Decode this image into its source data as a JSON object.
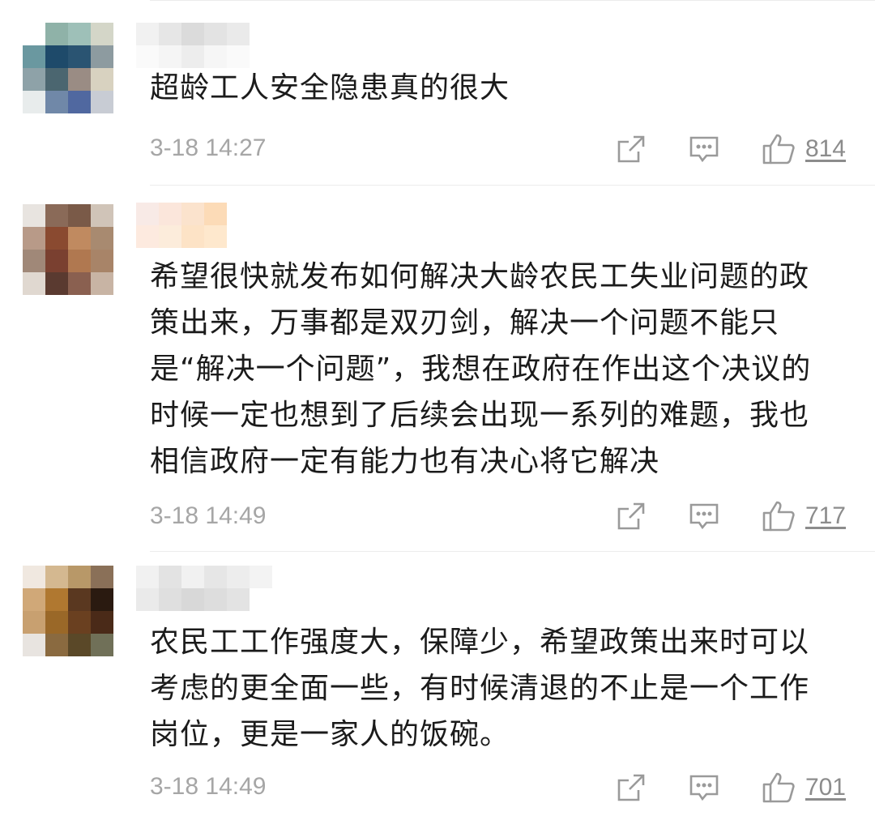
{
  "comments": [
    {
      "text": "超龄工人安全隐患真的很大",
      "time": "3-18 14:27",
      "likes": "814",
      "avatar_colors": [
        "#ffffff",
        "#8fb2a8",
        "#9ec0b8",
        "#d4d6c8",
        "#6a98a0",
        "#1e4a6a",
        "#2a5472",
        "#8d9ba0",
        "#8ea2a8",
        "#4b6670",
        "#9a8c84",
        "#d8d2c0",
        "#e8ecec",
        "#7088a8",
        "#5068a0",
        "#c8ccd4"
      ],
      "username_colors": [
        "#f0f0f0",
        "#fafafa",
        "#e4e4e4",
        "#f4f4f4",
        "#d8d8d8",
        "#ececec",
        "#e0e0e0",
        "#f6f6f6",
        "#e8e8e8",
        "#fafafa"
      ]
    },
    {
      "text": "希望很快就发布如何解决大龄农民工失业问题的政策出来，万事都是双刃剑，解决一个问题不能只是“解决一个问题”，我想在政府在作出这个决议的时候一定也想到了后续会出现一系列的难题，我也相信政府一定有能力也有决心将它解决",
      "time": "3-18 14:49",
      "likes": "717",
      "avatar_colors": [
        "#e8e4e0",
        "#8a6a58",
        "#7a5a48",
        "#d0c4b8",
        "#b89a88",
        "#8a4a30",
        "#c08a60",
        "#a88a70",
        "#a08878",
        "#7a4030",
        "#b07850",
        "#a88468",
        "#e0d8d0",
        "#5a3a30",
        "#8a6050",
        "#c8b4a4"
      ],
      "username_colors": [
        "#f8e8e4",
        "#fde8dc",
        "#fbe4d8",
        "#fcebd8",
        "#fbe0c8",
        "#fde0c0",
        "#fcd8b0",
        "#fee6c8",
        "#ffffff",
        "#ffffff"
      ]
    },
    {
      "text": "农民工工作强度大，保障少，希望政策出来时可以考虑的更全面一些，有时候清退的不止是一个工作岗位，更是一家人的饭碗。",
      "time": "3-18 14:49",
      "likes": "701",
      "avatar_colors": [
        "#f0e8e0",
        "#d4b890",
        "#b89868",
        "#8a7058",
        "#d0a878",
        "#b07830",
        "#5a3820",
        "#2a1a10",
        "#c8a070",
        "#9a6828",
        "#6a4020",
        "#4a2a18",
        "#e8e4e0",
        "#8a6a40",
        "#5a4828",
        "#707058"
      ],
      "username_colors": [
        "#f0f0f0",
        "#e8e8e8",
        "#e0e0e0",
        "#dcdcdc",
        "#f0f0f0",
        "#d4d4d4",
        "#e4e4e4",
        "#dadada",
        "#ececec",
        "#e0e0e0",
        "#f2f2f2",
        "#ffffff"
      ]
    }
  ],
  "icons": {
    "share": "share-icon",
    "comment": "comment-icon",
    "like": "thumbs-up-icon"
  },
  "colors": {
    "text": "#1b1b1b",
    "meta": "#a6a6a6",
    "icon": "#9a9a9a"
  }
}
